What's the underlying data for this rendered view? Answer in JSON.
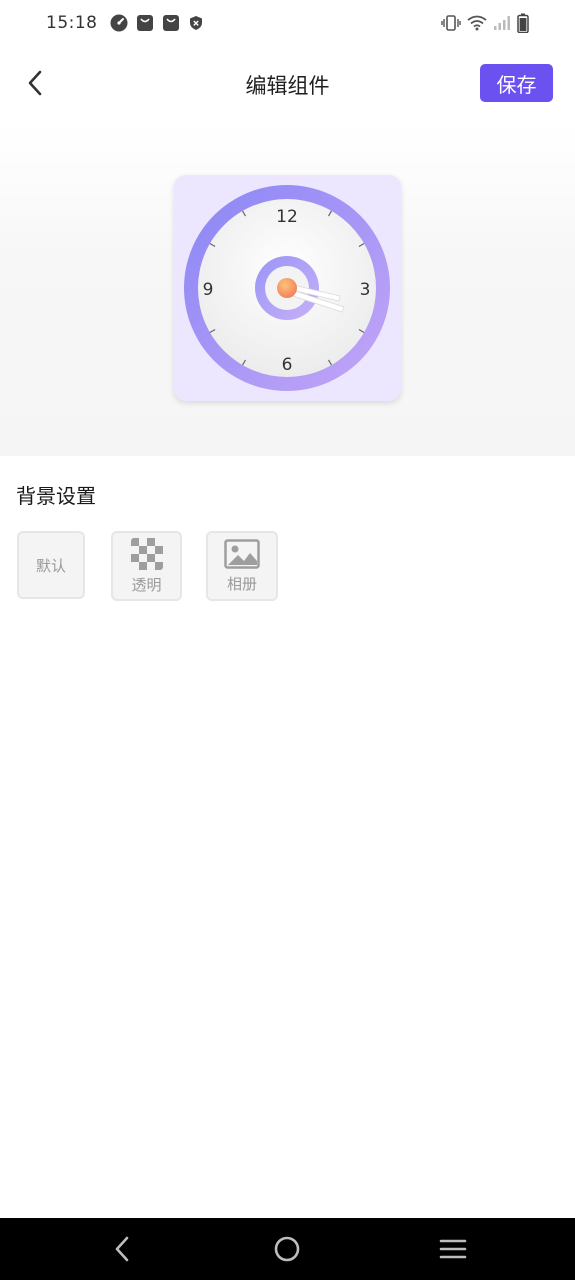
{
  "status_bar": {
    "time": "15:18",
    "left_icons": [
      "speedometer-icon",
      "bag-icon",
      "bag-icon",
      "shield-icon"
    ],
    "right_icons": [
      "vibrate-icon",
      "wifi-icon",
      "signal-icon",
      "battery-icon"
    ]
  },
  "header": {
    "title": "编辑组件",
    "save_label": "保存"
  },
  "widget": {
    "card_color": "#ece7ff",
    "ring_colors": [
      "#8a86f5",
      "#c4a6f7"
    ],
    "numbers": {
      "n12": "12",
      "n3": "3",
      "n6": "6",
      "n9": "9"
    },
    "center_color": "#f79a5c"
  },
  "background_settings": {
    "title": "背景设置",
    "options": [
      {
        "label": "默认"
      },
      {
        "label": "透明"
      },
      {
        "label": "相册"
      }
    ]
  },
  "colors": {
    "accent": "#6b52f0"
  }
}
